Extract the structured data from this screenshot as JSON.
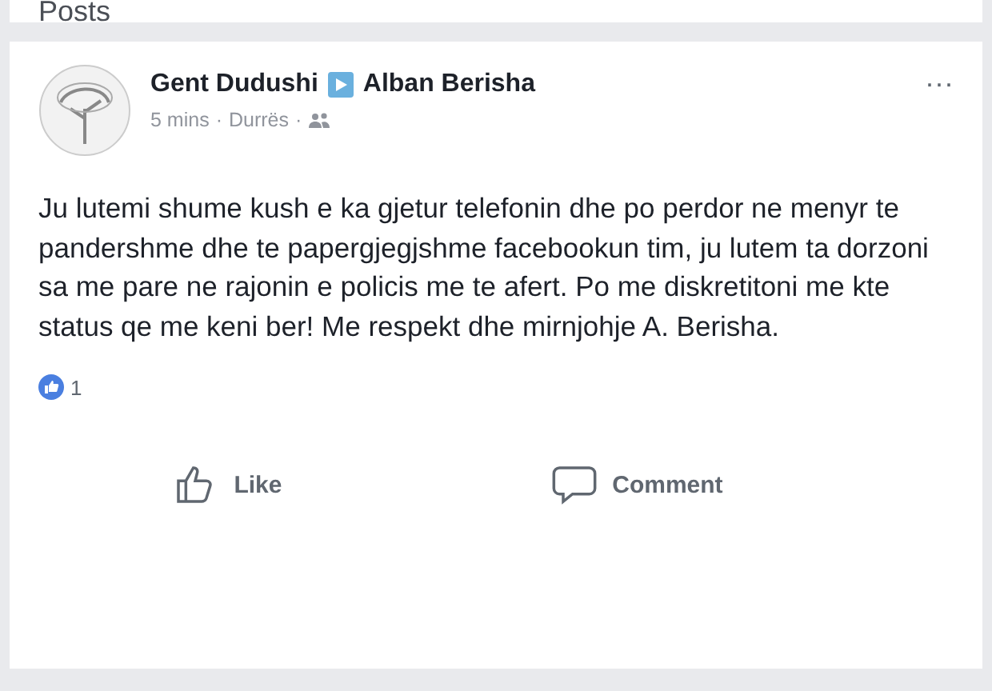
{
  "section_header": {
    "title": "Posts"
  },
  "post": {
    "author": "Gent Dudushi",
    "recipient": "Alban Berisha",
    "time": "5 mins",
    "location": "Durrës",
    "separator": "·",
    "text": "Ju lutemi shume kush e ka gjetur telefonin dhe po perdor ne menyr te pandershme dhe te papergjegjshme facebookun tim, ju lutem ta dorzoni sa me pare ne rajonin e policis me te afert. Po me diskretitoni me kte status qe me keni ber! Me respekt dhe mirnjohje A. Berisha.",
    "more": "···",
    "reaction_count": "1",
    "actions": [
      {
        "kind": "like",
        "label": "Like"
      },
      {
        "kind": "comment",
        "label": "Comment"
      }
    ]
  }
}
